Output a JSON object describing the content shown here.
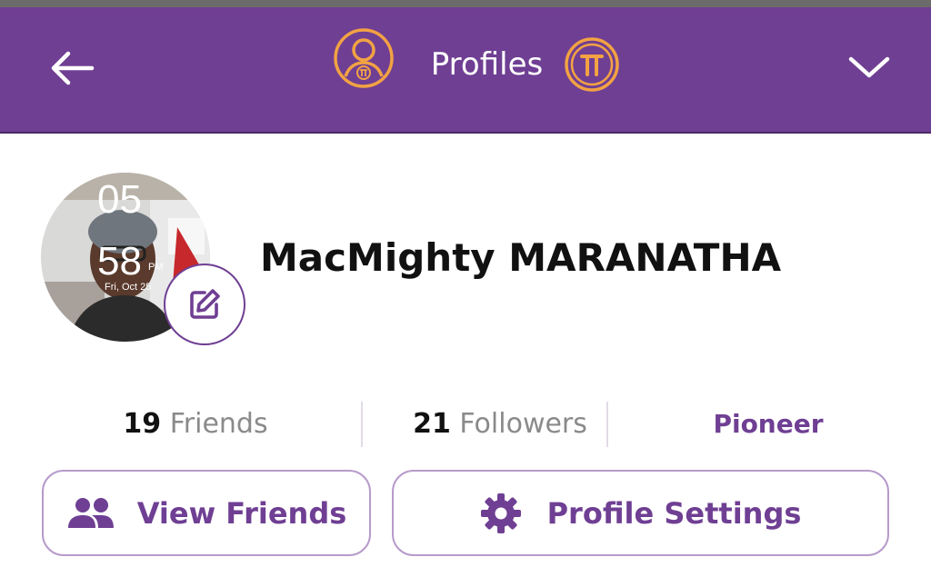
{
  "header": {
    "title": "Profiles",
    "back_icon": "arrow-left-icon",
    "profile_icon": "pi-user-icon",
    "pi_icon": "pi-coin-icon",
    "dropdown_icon": "chevron-down-icon"
  },
  "profile": {
    "name": "MacMighty MARANATHA",
    "avatar_clock_hour": "05",
    "avatar_clock_minute": "58",
    "avatar_clock_ampm": "PM",
    "avatar_clock_date": "Fri, Oct 25",
    "edit_icon": "edit-icon"
  },
  "stats": {
    "friends_count": "19",
    "friends_label": "Friends",
    "followers_count": "21",
    "followers_label": "Followers",
    "role": "Pioneer"
  },
  "actions": {
    "view_friends": "View Friends",
    "profile_settings": "Profile Settings",
    "friends_icon": "people-icon",
    "settings_icon": "gear-icon"
  },
  "colors": {
    "brand_purple": "#6f3f93",
    "accent_orange": "#f2a243",
    "button_border": "#b79bcb"
  }
}
